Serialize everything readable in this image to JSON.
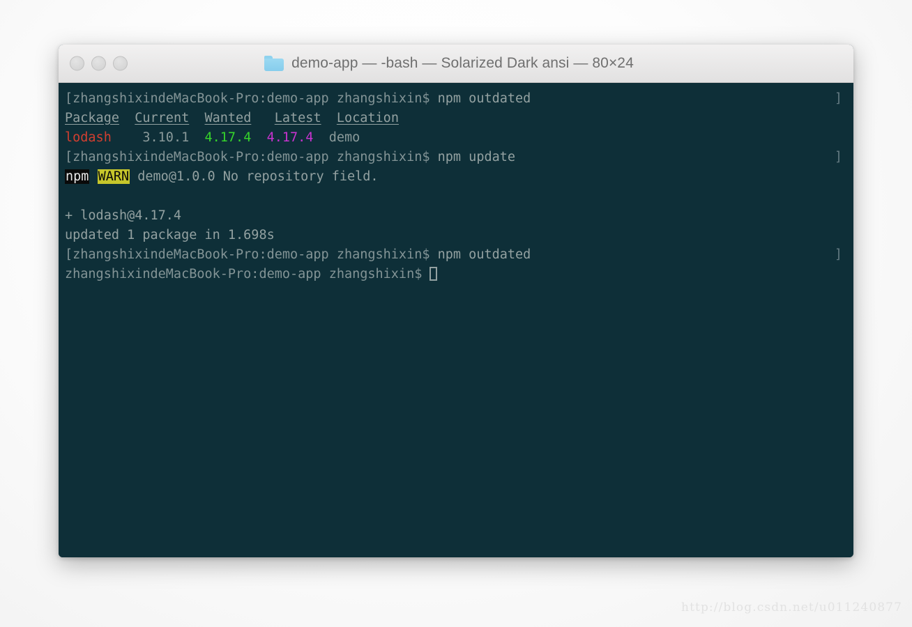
{
  "window": {
    "title": "demo-app — -bash — Solarized Dark ansi — 80×24",
    "folder_icon": "folder-icon",
    "traffic_lights": [
      {
        "name": "close-button",
        "label": "Close"
      },
      {
        "name": "minimize-button",
        "label": "Minimize"
      },
      {
        "name": "zoom-button",
        "label": "Zoom"
      }
    ]
  },
  "colors": {
    "terminal_background": "#0e2f38",
    "terminal_foreground": "#93a1a1",
    "titlebar_background": "#e9e8e8",
    "titlebar_text": "#6f6f6f",
    "ansi_red": "#d33f30",
    "ansi_green": "#36d42b",
    "ansi_magenta": "#c933d0",
    "ansi_yellow_bg": "#c6c62b",
    "npm_tag_bg": "#0a0a0a",
    "folder_icon": "#86cdec",
    "page_background": "#ffffff"
  },
  "terminal": {
    "prompt": "zhangshixindeMacBook-Pro:demo-app zhangshixin$",
    "bracketed_paste_marker": "]",
    "lines": [
      {
        "id": "cmd-npm-outdated-1",
        "type": "prompt",
        "prompt": "[zhangshixindeMacBook-Pro:demo-app zhangshixin$ ",
        "command": "npm outdated",
        "right_marker": "]"
      },
      {
        "id": "outdated-header",
        "type": "table-header",
        "cells": [
          "Package",
          "Current",
          "Wanted",
          "Latest",
          "Location"
        ]
      },
      {
        "id": "outdated-row-lodash",
        "type": "table-row",
        "package": "lodash",
        "current": "3.10.1",
        "wanted": "4.17.4",
        "latest": "4.17.4",
        "location": "demo"
      },
      {
        "id": "cmd-npm-update",
        "type": "prompt",
        "prompt": "[zhangshixindeMacBook-Pro:demo-app zhangshixin$ ",
        "command": "npm update",
        "right_marker": "]"
      },
      {
        "id": "warn-line",
        "type": "warning",
        "tag": "npm",
        "level": "WARN",
        "message": "demo@1.0.0 No repository field."
      },
      {
        "id": "blank-1",
        "type": "blank",
        "text": ""
      },
      {
        "id": "added-pkg",
        "type": "output",
        "text": "+ lodash@4.17.4"
      },
      {
        "id": "update-summary",
        "type": "output",
        "text": "updated 1 package in 1.698s"
      },
      {
        "id": "cmd-npm-outdated-2",
        "type": "prompt",
        "prompt": "[zhangshixindeMacBook-Pro:demo-app zhangshixin$ ",
        "command": "npm outdated",
        "right_marker": "]"
      },
      {
        "id": "final-prompt",
        "type": "prompt-cursor",
        "prompt": "zhangshixindeMacBook-Pro:demo-app zhangshixin$ ",
        "command": "",
        "cursor": "block"
      }
    ]
  },
  "watermark": {
    "text": "http://blog.csdn.net/u011240877"
  }
}
